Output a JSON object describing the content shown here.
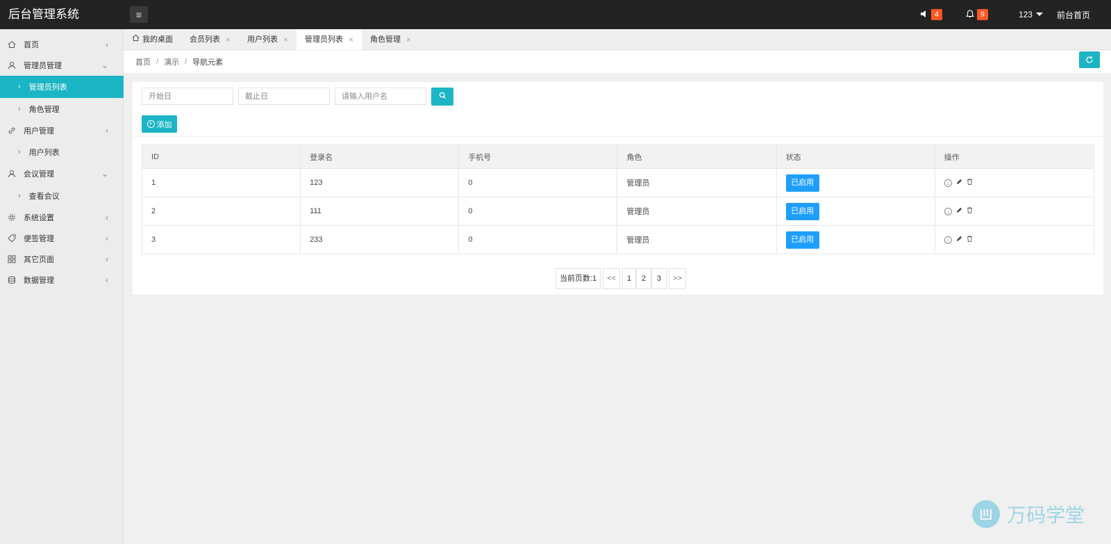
{
  "app": {
    "title": "后台管理系统"
  },
  "topbar": {
    "menu_icon": "hamburger-icon",
    "speaker_count": "4",
    "bell_count": "9",
    "user": "123",
    "front_link": "前台首页"
  },
  "sidebar": {
    "items": [
      {
        "label": "首页",
        "icon": "home-icon"
      },
      {
        "label": "管理员管理",
        "icon": "admin-icon"
      },
      {
        "label": "管理员列表"
      },
      {
        "label": "角色管理"
      },
      {
        "label": "用户管理",
        "icon": "link-icon"
      },
      {
        "label": "用户列表"
      },
      {
        "label": "会议管理",
        "icon": "user-icon"
      },
      {
        "label": "查看会议"
      },
      {
        "label": "系统设置",
        "icon": "gear-icon"
      },
      {
        "label": "便签管理",
        "icon": "tag-icon"
      },
      {
        "label": "其它页面",
        "icon": "grid-icon"
      },
      {
        "label": "数据管理",
        "icon": "database-icon"
      }
    ]
  },
  "tabs": [
    {
      "label": "我的桌面"
    },
    {
      "label": "会员列表"
    },
    {
      "label": "用户列表"
    },
    {
      "label": "管理员列表"
    },
    {
      "label": "角色管理"
    }
  ],
  "breadcrumb": {
    "items": [
      "首页",
      "演示",
      "导航元素"
    ]
  },
  "filters": {
    "start_placeholder": "开始日",
    "end_placeholder": "截止日",
    "user_placeholder": "请输入用户名"
  },
  "add_label": "添加",
  "table": {
    "headers": [
      "ID",
      "登录名",
      "手机号",
      "角色",
      "状态",
      "操作"
    ],
    "rows": [
      {
        "id": "1",
        "login": "123",
        "phone": "0",
        "role": "管理员",
        "status": "已启用"
      },
      {
        "id": "2",
        "login": "111",
        "phone": "0",
        "role": "管理员",
        "status": "已启用"
      },
      {
        "id": "3",
        "login": "233",
        "phone": "0",
        "role": "管理员",
        "status": "已启用"
      }
    ]
  },
  "pagination": {
    "info": "当前页数:1",
    "prev": "<<",
    "pages": [
      "1",
      "2",
      "3"
    ],
    "next": ">>"
  },
  "watermark": {
    "text": "万码学堂"
  },
  "colors": {
    "accent": "#1cb5c5",
    "status": "#1e9fff",
    "badge": "#ff5722",
    "topbar": "#232323"
  }
}
